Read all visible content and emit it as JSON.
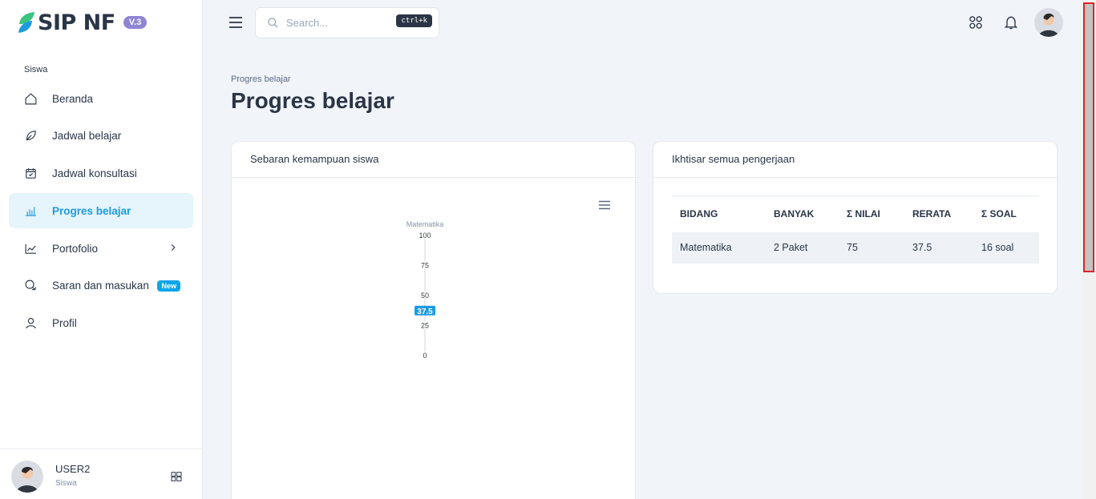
{
  "brand": {
    "name": "SIP NF",
    "version": "V.3"
  },
  "sidebar": {
    "section": "Siswa",
    "items": [
      {
        "label": "Beranda",
        "icon": "home-icon"
      },
      {
        "label": "Jadwal belajar",
        "icon": "leaf-icon"
      },
      {
        "label": "Jadwal konsultasi",
        "icon": "calendar-check-icon"
      },
      {
        "label": "Progres belajar",
        "icon": "chart-bar-icon",
        "active": true
      },
      {
        "label": "Portofolio",
        "icon": "chart-line-icon",
        "has_chevron": true
      },
      {
        "label": "Saran dan masukan",
        "icon": "chat-icon",
        "badge": "New"
      },
      {
        "label": "Profil",
        "icon": "user-icon"
      }
    ],
    "footer": {
      "name": "USER2",
      "role": "Siswa"
    }
  },
  "topbar": {
    "search_placeholder": "Search...",
    "shortcut": "ctrl+k"
  },
  "page": {
    "breadcrumb": "Progres belajar",
    "title": "Progres belajar"
  },
  "chart_card": {
    "title": "Sebaran kemampuan siswa"
  },
  "chart_data": {
    "type": "bar",
    "categories": [
      "Matematika"
    ],
    "values": [
      37.5
    ],
    "ylim": [
      0,
      100
    ],
    "yticks": [
      "100",
      "75",
      "50",
      "25",
      "0"
    ],
    "data_label": "37.5"
  },
  "summary_card": {
    "title": "Ikhtisar semua pengerjaan",
    "columns": [
      "BIDANG",
      "BANYAK",
      "Σ NILAI",
      "RERATA",
      "Σ SOAL"
    ],
    "rows": [
      [
        "Matematika",
        "2 Paket",
        "75",
        "37.5",
        "16 soal"
      ]
    ]
  },
  "colors": {
    "accent": "#1e9be0",
    "badge": "#0ea5e9",
    "version_badge": "#8f84d6"
  }
}
